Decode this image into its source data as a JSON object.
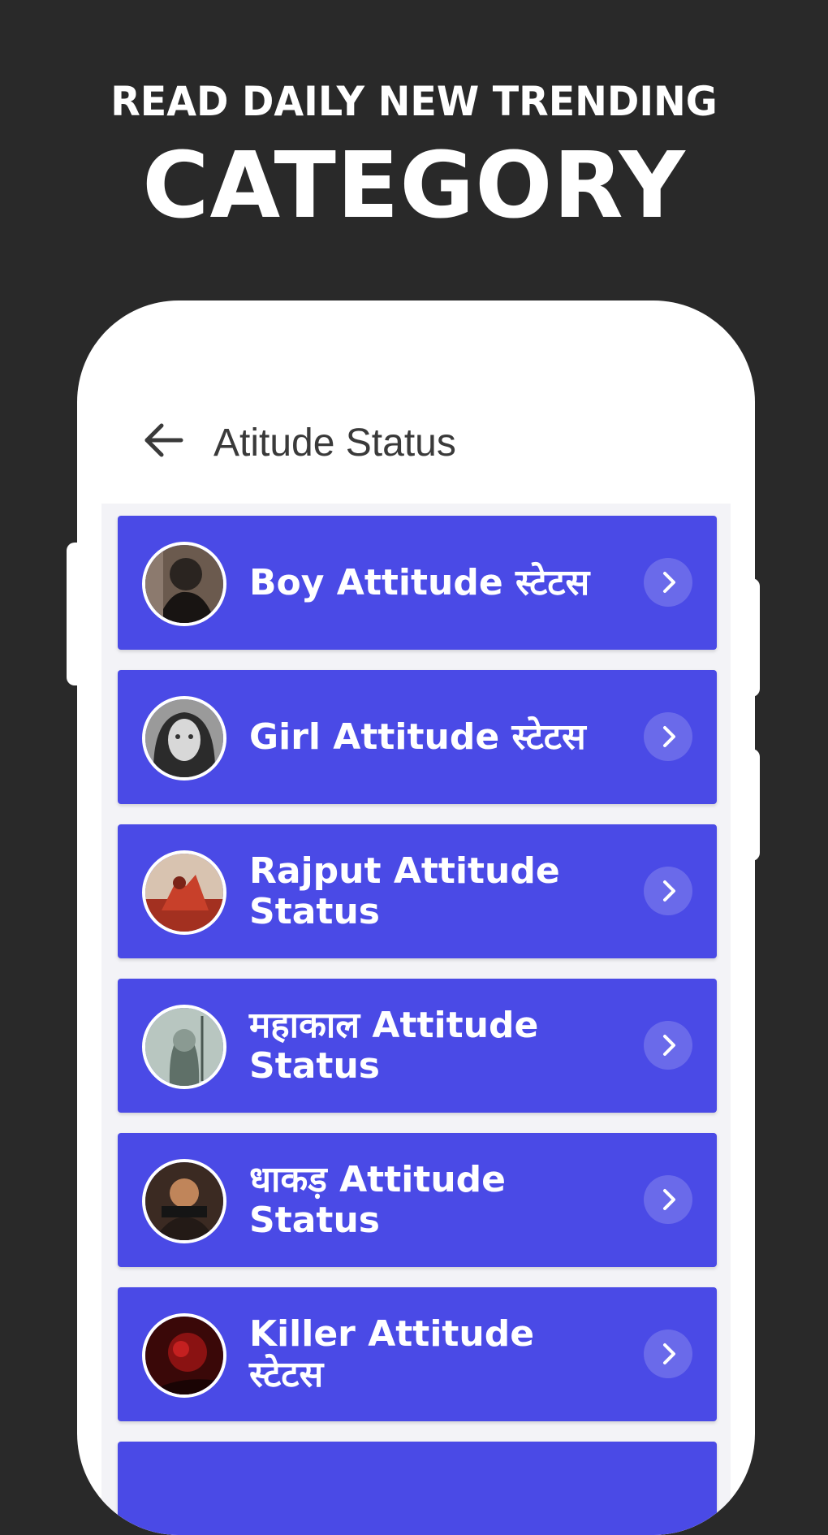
{
  "promo": {
    "headline_top": "READ DAILY NEW TRENDING",
    "headline_main": "CATEGORY"
  },
  "app_bar": {
    "title": "Atitude Status",
    "back_icon": "arrow-left-icon"
  },
  "list": {
    "items": [
      {
        "label": "Boy Attitude स्टेटस",
        "avatar": "boy-avatar",
        "chevron_icon": "chevron-right-icon"
      },
      {
        "label": "Girl Attitude स्टेटस",
        "avatar": "girl-avatar",
        "chevron_icon": "chevron-right-icon"
      },
      {
        "label": "Rajput Attitude Status",
        "avatar": "rajput-avatar",
        "chevron_icon": "chevron-right-icon"
      },
      {
        "label": "महाकाल Attitude Status",
        "avatar": "mahakal-avatar",
        "chevron_icon": "chevron-right-icon"
      },
      {
        "label": "धाकड़ Attitude Status",
        "avatar": "dhakad-avatar",
        "chevron_icon": "chevron-right-icon"
      },
      {
        "label": "Killer Attitude स्टेटस",
        "avatar": "killer-avatar",
        "chevron_icon": "chevron-right-icon"
      }
    ]
  },
  "colors": {
    "background": "#292929",
    "accent": "#4a4ae6",
    "phone": "#ffffff",
    "text_light": "#ffffff"
  }
}
